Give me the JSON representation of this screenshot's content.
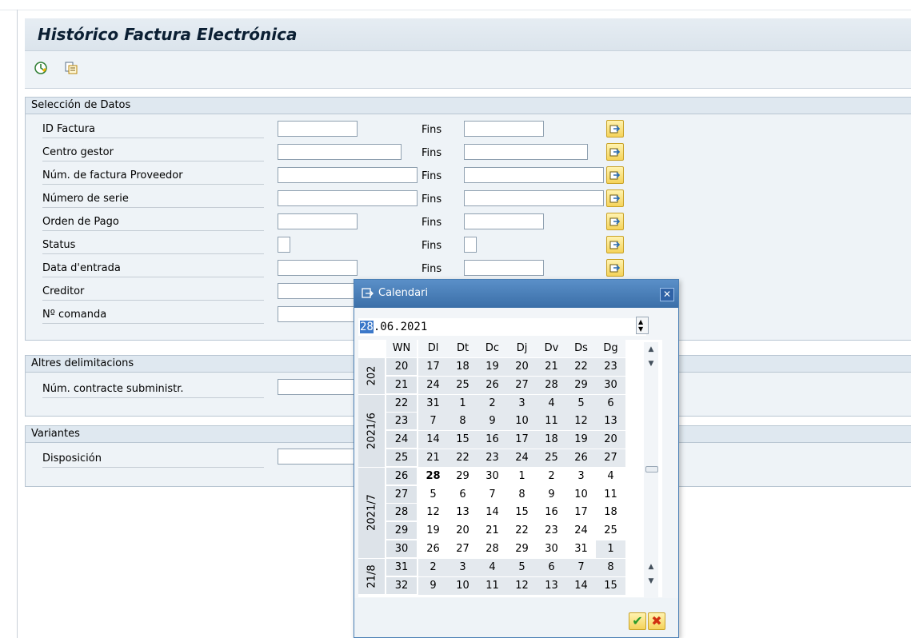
{
  "window": {
    "title": "Histórico Factura Electrónica"
  },
  "toolbar": {
    "items": [
      {
        "icon": "execute-clock-icon"
      },
      {
        "icon": "copy-variant-icon"
      }
    ]
  },
  "seleccion": {
    "header": "Selección de Datos",
    "to_label": "Fins",
    "fields": [
      {
        "label": "ID Factura",
        "from": "",
        "to": ""
      },
      {
        "label": "Centro gestor",
        "from": "",
        "to": ""
      },
      {
        "label": "Núm. de factura Proveedor",
        "from": "",
        "to": ""
      },
      {
        "label": "Número de serie",
        "from": "",
        "to": ""
      },
      {
        "label": "Orden de Pago",
        "from": "",
        "to": ""
      },
      {
        "label": "Status",
        "from": "",
        "to": ""
      },
      {
        "label": "Data d'entrada",
        "from": "",
        "to": ""
      },
      {
        "label": "Creditor",
        "from": ""
      },
      {
        "label": "Nº comanda",
        "from": ""
      }
    ]
  },
  "altres": {
    "header": "Altres delimitacions",
    "fields": [
      {
        "label": "Núm. contracte subministr.",
        "value": ""
      }
    ]
  },
  "variantes": {
    "header": "Variantes",
    "fields": [
      {
        "label": "Disposición",
        "value": ""
      }
    ]
  },
  "calendar": {
    "title": "Calendari",
    "date_value_selected": "28",
    "date_value_rest": ".06.2021",
    "headers": [
      "WN",
      "Dl",
      "Dt",
      "Dc",
      "Dj",
      "Dv",
      "Ds",
      "Dg"
    ],
    "month_groups": [
      {
        "label": "202"
      },
      {
        "label": "2021/6"
      },
      {
        "label": "2021/7"
      },
      {
        "label": "21/8"
      }
    ],
    "weeks": [
      {
        "wn": "20",
        "days": [
          "17",
          "18",
          "19",
          "20",
          "21",
          "22",
          "23"
        ]
      },
      {
        "wn": "21",
        "days": [
          "24",
          "25",
          "26",
          "27",
          "28",
          "29",
          "30"
        ]
      },
      {
        "wn": "22",
        "days": [
          "31",
          "1",
          "2",
          "3",
          "4",
          "5",
          "6"
        ]
      },
      {
        "wn": "23",
        "days": [
          "7",
          "8",
          "9",
          "10",
          "11",
          "12",
          "13"
        ]
      },
      {
        "wn": "24",
        "days": [
          "14",
          "15",
          "16",
          "17",
          "18",
          "19",
          "20"
        ]
      },
      {
        "wn": "25",
        "days": [
          "21",
          "22",
          "23",
          "24",
          "25",
          "26",
          "27"
        ]
      },
      {
        "wn": "26",
        "days": [
          "28",
          "29",
          "30",
          "1",
          "2",
          "3",
          "4"
        ]
      },
      {
        "wn": "27",
        "days": [
          "5",
          "6",
          "7",
          "8",
          "9",
          "10",
          "11"
        ]
      },
      {
        "wn": "28",
        "days": [
          "12",
          "13",
          "14",
          "15",
          "16",
          "17",
          "18"
        ]
      },
      {
        "wn": "29",
        "days": [
          "19",
          "20",
          "21",
          "22",
          "23",
          "24",
          "25"
        ]
      },
      {
        "wn": "30",
        "days": [
          "26",
          "27",
          "28",
          "29",
          "30",
          "31",
          "1"
        ]
      },
      {
        "wn": "31",
        "days": [
          "2",
          "3",
          "4",
          "5",
          "6",
          "7",
          "8"
        ]
      },
      {
        "wn": "32",
        "days": [
          "9",
          "10",
          "11",
          "12",
          "13",
          "14",
          "15"
        ]
      }
    ],
    "today": "28",
    "colors": {
      "shaded": "#e4e9ee",
      "white": "#ffffff",
      "accent": "#3b78c9"
    }
  }
}
